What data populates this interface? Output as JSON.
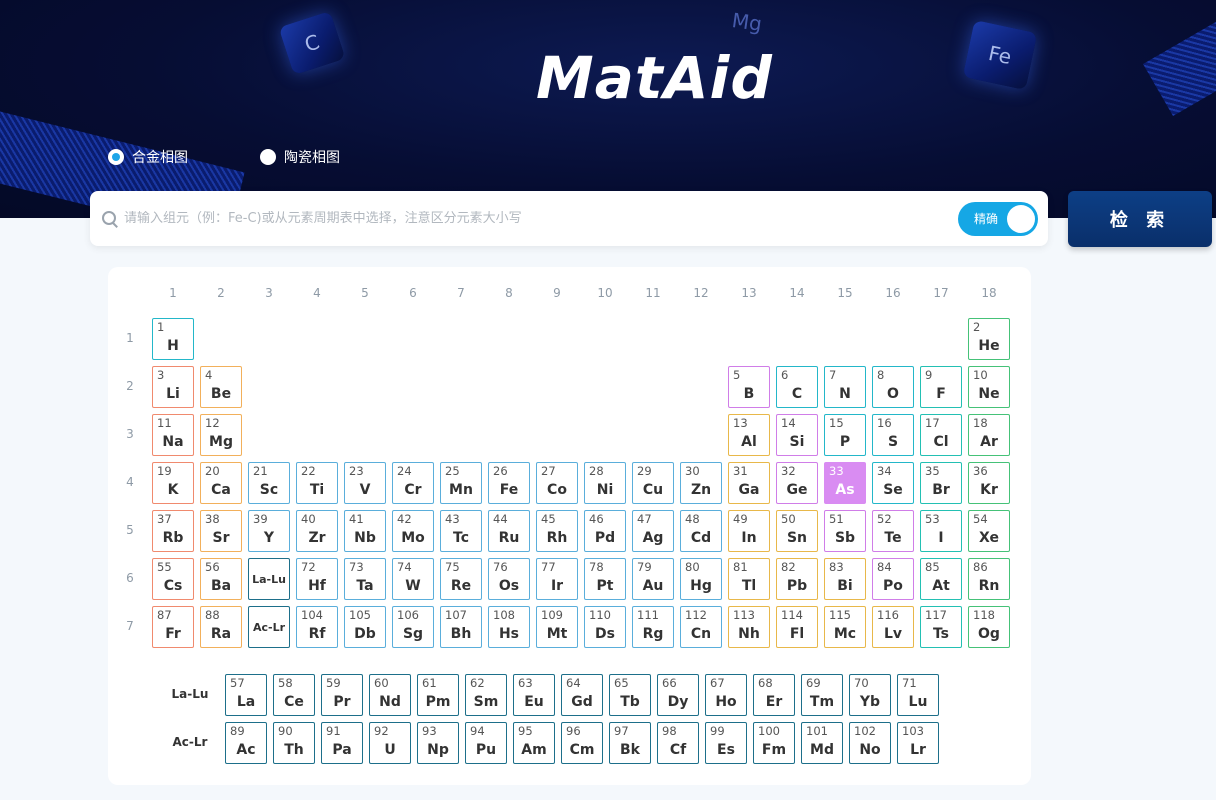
{
  "app": {
    "logo_text": "MatAid",
    "hero_decorations": [
      "Mg",
      "C",
      "Fe"
    ]
  },
  "phase_type": {
    "options": [
      {
        "label": "合金相图",
        "checked": true
      },
      {
        "label": "陶瓷相图",
        "checked": false
      }
    ]
  },
  "search": {
    "placeholder": "请输入组元（例：Fe-C)或从元素周期表中选择，注意区分元素大小写",
    "value": "",
    "exact_toggle_label": "精确",
    "exact_toggle_on": true,
    "button_label": "检 索"
  },
  "periodic_table": {
    "group_numbers": [
      "1",
      "2",
      "3",
      "4",
      "5",
      "6",
      "7",
      "8",
      "9",
      "10",
      "11",
      "12",
      "13",
      "14",
      "15",
      "16",
      "17",
      "18"
    ],
    "period_numbers": [
      "1",
      "2",
      "3",
      "4",
      "5",
      "6",
      "7"
    ],
    "category_colors": {
      "alkali": "#f08a6e",
      "alkaline": "#f2b05b",
      "transition": "#5aaedb",
      "post_transition": "#e8b84a",
      "metalloid": "#d07de8",
      "nonmetal": "#23b7c9",
      "halogen": "#23c0b3",
      "noble": "#45c278",
      "lanthanide": "#1d6f8a",
      "actinide": "#1d6f8a"
    },
    "selected_element": "As",
    "selected_color": "#d98cf2",
    "range_placeholders": {
      "lanthanides": "La-Lu",
      "actinides": "Ac-Lr"
    },
    "elements": [
      {
        "n": "1",
        "s": "H",
        "p": 1,
        "g": 1,
        "c": "nonmetal"
      },
      {
        "n": "2",
        "s": "He",
        "p": 1,
        "g": 18,
        "c": "noble"
      },
      {
        "n": "3",
        "s": "Li",
        "p": 2,
        "g": 1,
        "c": "alkali"
      },
      {
        "n": "4",
        "s": "Be",
        "p": 2,
        "g": 2,
        "c": "alkaline"
      },
      {
        "n": "5",
        "s": "B",
        "p": 2,
        "g": 13,
        "c": "metalloid"
      },
      {
        "n": "6",
        "s": "C",
        "p": 2,
        "g": 14,
        "c": "nonmetal"
      },
      {
        "n": "7",
        "s": "N",
        "p": 2,
        "g": 15,
        "c": "nonmetal"
      },
      {
        "n": "8",
        "s": "O",
        "p": 2,
        "g": 16,
        "c": "nonmetal"
      },
      {
        "n": "9",
        "s": "F",
        "p": 2,
        "g": 17,
        "c": "halogen"
      },
      {
        "n": "10",
        "s": "Ne",
        "p": 2,
        "g": 18,
        "c": "noble"
      },
      {
        "n": "11",
        "s": "Na",
        "p": 3,
        "g": 1,
        "c": "alkali"
      },
      {
        "n": "12",
        "s": "Mg",
        "p": 3,
        "g": 2,
        "c": "alkaline"
      },
      {
        "n": "13",
        "s": "Al",
        "p": 3,
        "g": 13,
        "c": "post_transition"
      },
      {
        "n": "14",
        "s": "Si",
        "p": 3,
        "g": 14,
        "c": "metalloid"
      },
      {
        "n": "15",
        "s": "P",
        "p": 3,
        "g": 15,
        "c": "nonmetal"
      },
      {
        "n": "16",
        "s": "S",
        "p": 3,
        "g": 16,
        "c": "nonmetal"
      },
      {
        "n": "17",
        "s": "Cl",
        "p": 3,
        "g": 17,
        "c": "halogen"
      },
      {
        "n": "18",
        "s": "Ar",
        "p": 3,
        "g": 18,
        "c": "noble"
      },
      {
        "n": "19",
        "s": "K",
        "p": 4,
        "g": 1,
        "c": "alkali"
      },
      {
        "n": "20",
        "s": "Ca",
        "p": 4,
        "g": 2,
        "c": "alkaline"
      },
      {
        "n": "21",
        "s": "Sc",
        "p": 4,
        "g": 3,
        "c": "transition"
      },
      {
        "n": "22",
        "s": "Ti",
        "p": 4,
        "g": 4,
        "c": "transition"
      },
      {
        "n": "23",
        "s": "V",
        "p": 4,
        "g": 5,
        "c": "transition"
      },
      {
        "n": "24",
        "s": "Cr",
        "p": 4,
        "g": 6,
        "c": "transition"
      },
      {
        "n": "25",
        "s": "Mn",
        "p": 4,
        "g": 7,
        "c": "transition"
      },
      {
        "n": "26",
        "s": "Fe",
        "p": 4,
        "g": 8,
        "c": "transition"
      },
      {
        "n": "27",
        "s": "Co",
        "p": 4,
        "g": 9,
        "c": "transition"
      },
      {
        "n": "28",
        "s": "Ni",
        "p": 4,
        "g": 10,
        "c": "transition"
      },
      {
        "n": "29",
        "s": "Cu",
        "p": 4,
        "g": 11,
        "c": "transition"
      },
      {
        "n": "30",
        "s": "Zn",
        "p": 4,
        "g": 12,
        "c": "transition"
      },
      {
        "n": "31",
        "s": "Ga",
        "p": 4,
        "g": 13,
        "c": "post_transition"
      },
      {
        "n": "32",
        "s": "Ge",
        "p": 4,
        "g": 14,
        "c": "metalloid"
      },
      {
        "n": "33",
        "s": "As",
        "p": 4,
        "g": 15,
        "c": "metalloid"
      },
      {
        "n": "34",
        "s": "Se",
        "p": 4,
        "g": 16,
        "c": "nonmetal"
      },
      {
        "n": "35",
        "s": "Br",
        "p": 4,
        "g": 17,
        "c": "halogen"
      },
      {
        "n": "36",
        "s": "Kr",
        "p": 4,
        "g": 18,
        "c": "noble"
      },
      {
        "n": "37",
        "s": "Rb",
        "p": 5,
        "g": 1,
        "c": "alkali"
      },
      {
        "n": "38",
        "s": "Sr",
        "p": 5,
        "g": 2,
        "c": "alkaline"
      },
      {
        "n": "39",
        "s": "Y",
        "p": 5,
        "g": 3,
        "c": "transition"
      },
      {
        "n": "40",
        "s": "Zr",
        "p": 5,
        "g": 4,
        "c": "transition"
      },
      {
        "n": "41",
        "s": "Nb",
        "p": 5,
        "g": 5,
        "c": "transition"
      },
      {
        "n": "42",
        "s": "Mo",
        "p": 5,
        "g": 6,
        "c": "transition"
      },
      {
        "n": "43",
        "s": "Tc",
        "p": 5,
        "g": 7,
        "c": "transition"
      },
      {
        "n": "44",
        "s": "Ru",
        "p": 5,
        "g": 8,
        "c": "transition"
      },
      {
        "n": "45",
        "s": "Rh",
        "p": 5,
        "g": 9,
        "c": "transition"
      },
      {
        "n": "46",
        "s": "Pd",
        "p": 5,
        "g": 10,
        "c": "transition"
      },
      {
        "n": "47",
        "s": "Ag",
        "p": 5,
        "g": 11,
        "c": "transition"
      },
      {
        "n": "48",
        "s": "Cd",
        "p": 5,
        "g": 12,
        "c": "transition"
      },
      {
        "n": "49",
        "s": "In",
        "p": 5,
        "g": 13,
        "c": "post_transition"
      },
      {
        "n": "50",
        "s": "Sn",
        "p": 5,
        "g": 14,
        "c": "post_transition"
      },
      {
        "n": "51",
        "s": "Sb",
        "p": 5,
        "g": 15,
        "c": "metalloid"
      },
      {
        "n": "52",
        "s": "Te",
        "p": 5,
        "g": 16,
        "c": "metalloid"
      },
      {
        "n": "53",
        "s": "I",
        "p": 5,
        "g": 17,
        "c": "halogen"
      },
      {
        "n": "54",
        "s": "Xe",
        "p": 5,
        "g": 18,
        "c": "noble"
      },
      {
        "n": "55",
        "s": "Cs",
        "p": 6,
        "g": 1,
        "c": "alkali"
      },
      {
        "n": "56",
        "s": "Ba",
        "p": 6,
        "g": 2,
        "c": "alkaline"
      },
      {
        "n": "72",
        "s": "Hf",
        "p": 6,
        "g": 4,
        "c": "transition"
      },
      {
        "n": "73",
        "s": "Ta",
        "p": 6,
        "g": 5,
        "c": "transition"
      },
      {
        "n": "74",
        "s": "W",
        "p": 6,
        "g": 6,
        "c": "transition"
      },
      {
        "n": "75",
        "s": "Re",
        "p": 6,
        "g": 7,
        "c": "transition"
      },
      {
        "n": "76",
        "s": "Os",
        "p": 6,
        "g": 8,
        "c": "transition"
      },
      {
        "n": "77",
        "s": "Ir",
        "p": 6,
        "g": 9,
        "c": "transition"
      },
      {
        "n": "78",
        "s": "Pt",
        "p": 6,
        "g": 10,
        "c": "transition"
      },
      {
        "n": "79",
        "s": "Au",
        "p": 6,
        "g": 11,
        "c": "transition"
      },
      {
        "n": "80",
        "s": "Hg",
        "p": 6,
        "g": 12,
        "c": "transition"
      },
      {
        "n": "81",
        "s": "Tl",
        "p": 6,
        "g": 13,
        "c": "post_transition"
      },
      {
        "n": "82",
        "s": "Pb",
        "p": 6,
        "g": 14,
        "c": "post_transition"
      },
      {
        "n": "83",
        "s": "Bi",
        "p": 6,
        "g": 15,
        "c": "post_transition"
      },
      {
        "n": "84",
        "s": "Po",
        "p": 6,
        "g": 16,
        "c": "metalloid"
      },
      {
        "n": "85",
        "s": "At",
        "p": 6,
        "g": 17,
        "c": "halogen"
      },
      {
        "n": "86",
        "s": "Rn",
        "p": 6,
        "g": 18,
        "c": "noble"
      },
      {
        "n": "87",
        "s": "Fr",
        "p": 7,
        "g": 1,
        "c": "alkali"
      },
      {
        "n": "88",
        "s": "Ra",
        "p": 7,
        "g": 2,
        "c": "alkaline"
      },
      {
        "n": "104",
        "s": "Rf",
        "p": 7,
        "g": 4,
        "c": "transition"
      },
      {
        "n": "105",
        "s": "Db",
        "p": 7,
        "g": 5,
        "c": "transition"
      },
      {
        "n": "106",
        "s": "Sg",
        "p": 7,
        "g": 6,
        "c": "transition"
      },
      {
        "n": "107",
        "s": "Bh",
        "p": 7,
        "g": 7,
        "c": "transition"
      },
      {
        "n": "108",
        "s": "Hs",
        "p": 7,
        "g": 8,
        "c": "transition"
      },
      {
        "n": "109",
        "s": "Mt",
        "p": 7,
        "g": 9,
        "c": "transition"
      },
      {
        "n": "110",
        "s": "Ds",
        "p": 7,
        "g": 10,
        "c": "transition"
      },
      {
        "n": "111",
        "s": "Rg",
        "p": 7,
        "g": 11,
        "c": "transition"
      },
      {
        "n": "112",
        "s": "Cn",
        "p": 7,
        "g": 12,
        "c": "transition"
      },
      {
        "n": "113",
        "s": "Nh",
        "p": 7,
        "g": 13,
        "c": "post_transition"
      },
      {
        "n": "114",
        "s": "Fl",
        "p": 7,
        "g": 14,
        "c": "post_transition"
      },
      {
        "n": "115",
        "s": "Mc",
        "p": 7,
        "g": 15,
        "c": "post_transition"
      },
      {
        "n": "116",
        "s": "Lv",
        "p": 7,
        "g": 16,
        "c": "post_transition"
      },
      {
        "n": "117",
        "s": "Ts",
        "p": 7,
        "g": 17,
        "c": "halogen"
      },
      {
        "n": "118",
        "s": "Og",
        "p": 7,
        "g": 18,
        "c": "noble"
      }
    ],
    "lanthanides": {
      "label": "La-Lu",
      "elements": [
        {
          "n": "57",
          "s": "La"
        },
        {
          "n": "58",
          "s": "Ce"
        },
        {
          "n": "59",
          "s": "Pr"
        },
        {
          "n": "60",
          "s": "Nd"
        },
        {
          "n": "61",
          "s": "Pm"
        },
        {
          "n": "62",
          "s": "Sm"
        },
        {
          "n": "63",
          "s": "Eu"
        },
        {
          "n": "64",
          "s": "Gd"
        },
        {
          "n": "65",
          "s": "Tb"
        },
        {
          "n": "66",
          "s": "Dy"
        },
        {
          "n": "67",
          "s": "Ho"
        },
        {
          "n": "68",
          "s": "Er"
        },
        {
          "n": "69",
          "s": "Tm"
        },
        {
          "n": "70",
          "s": "Yb"
        },
        {
          "n": "71",
          "s": "Lu"
        }
      ]
    },
    "actinides": {
      "label": "Ac-Lr",
      "elements": [
        {
          "n": "89",
          "s": "Ac"
        },
        {
          "n": "90",
          "s": "Th"
        },
        {
          "n": "91",
          "s": "Pa"
        },
        {
          "n": "92",
          "s": "U"
        },
        {
          "n": "93",
          "s": "Np"
        },
        {
          "n": "94",
          "s": "Pu"
        },
        {
          "n": "95",
          "s": "Am"
        },
        {
          "n": "96",
          "s": "Cm"
        },
        {
          "n": "97",
          "s": "Bk"
        },
        {
          "n": "98",
          "s": "Cf"
        },
        {
          "n": "99",
          "s": "Es"
        },
        {
          "n": "100",
          "s": "Fm"
        },
        {
          "n": "101",
          "s": "Md"
        },
        {
          "n": "102",
          "s": "No"
        },
        {
          "n": "103",
          "s": "Lr"
        }
      ]
    }
  }
}
